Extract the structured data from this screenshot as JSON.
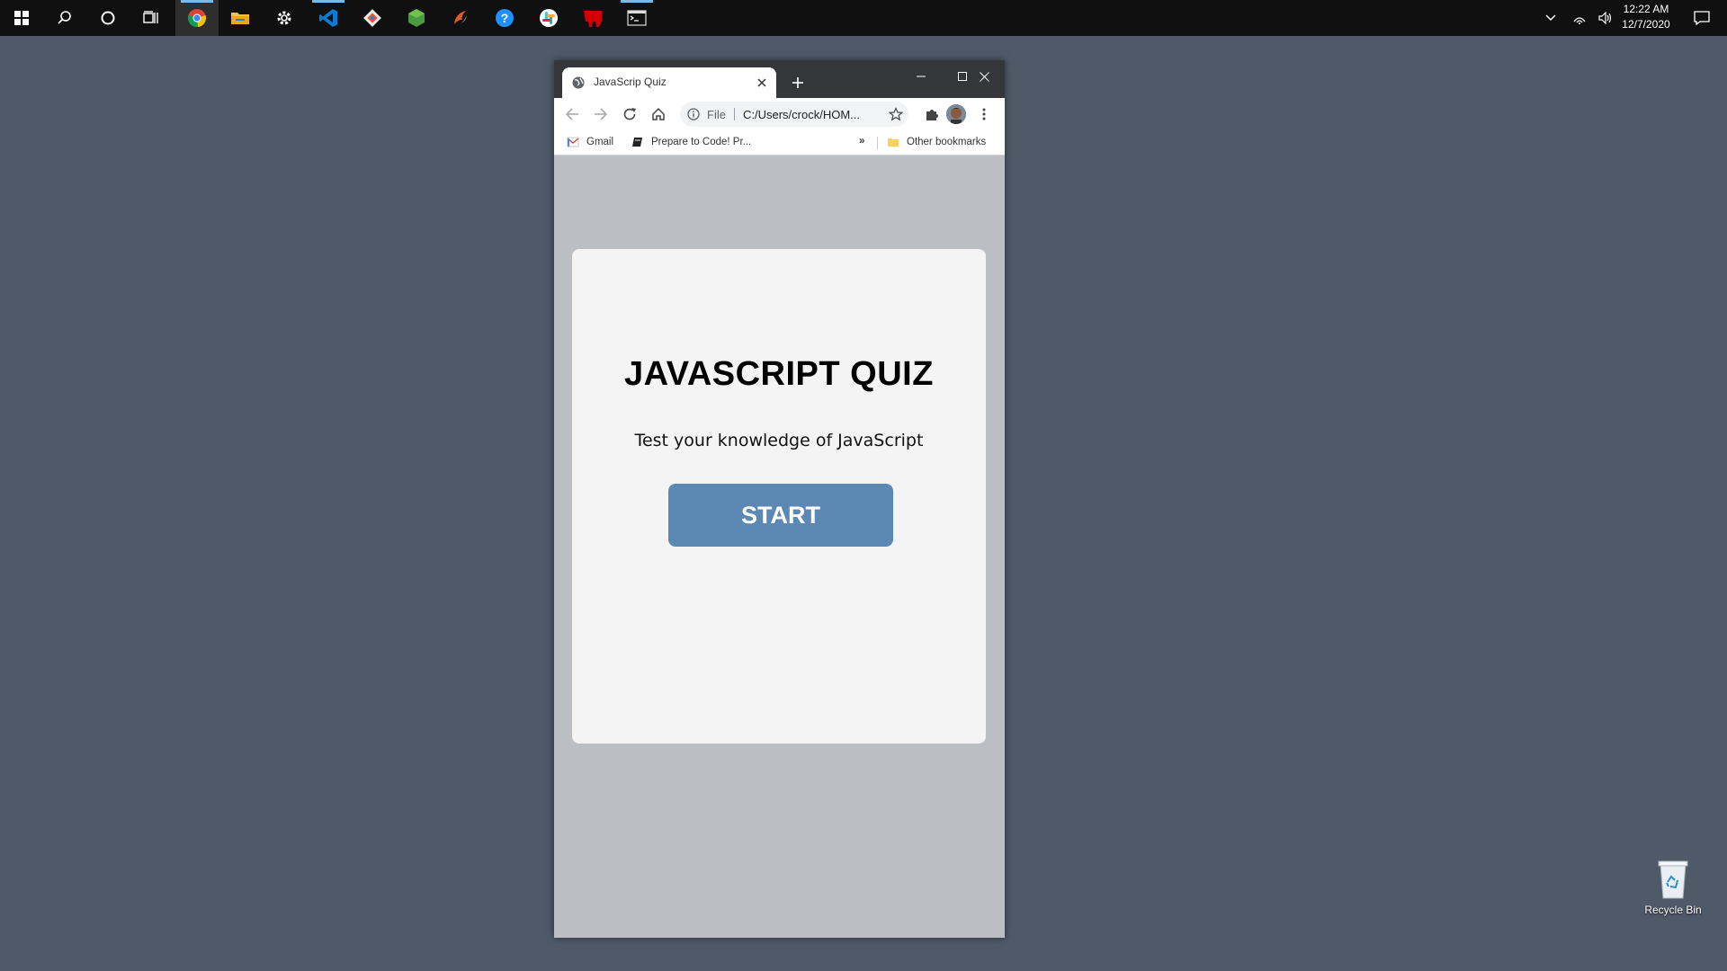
{
  "taskbar": {
    "apps": [
      {
        "name": "start-icon"
      },
      {
        "name": "search-icon"
      },
      {
        "name": "cortana-icon"
      },
      {
        "name": "task-view-icon"
      },
      {
        "name": "chrome-icon"
      },
      {
        "name": "file-explorer-icon"
      },
      {
        "name": "settings-icon"
      },
      {
        "name": "vscode-icon"
      },
      {
        "name": "git-icon"
      },
      {
        "name": "nodejs-icon"
      },
      {
        "name": "app-icon"
      },
      {
        "name": "help-icon"
      },
      {
        "name": "slack-icon"
      },
      {
        "name": "app-icon-red"
      },
      {
        "name": "terminal-icon"
      }
    ],
    "clock": {
      "time": "12:22 AM",
      "date": "12/7/2020"
    }
  },
  "browser": {
    "tab_title": "JavaScrip Quiz",
    "omnibox": {
      "scheme_label": "File",
      "url": "C:/Users/crock/HOM..."
    },
    "bookmarks": [
      {
        "label": "Gmail"
      },
      {
        "label": "Prepare to Code! Pr..."
      }
    ],
    "overflow_label": "»",
    "other_bookmarks": "Other bookmarks"
  },
  "page": {
    "title": "JAVASCRIPT QUIZ",
    "subtitle": "Test your knowledge of JavaScript",
    "start_label": "START"
  },
  "desktop": {
    "recycle_bin_label": "Recycle Bin"
  },
  "colors": {
    "desktop_bg": "#4f5a69",
    "page_bg": "#bbbfc3",
    "card_bg": "#f4f4f4",
    "start_button": "#5b89b3",
    "taskbar": "#101010"
  }
}
